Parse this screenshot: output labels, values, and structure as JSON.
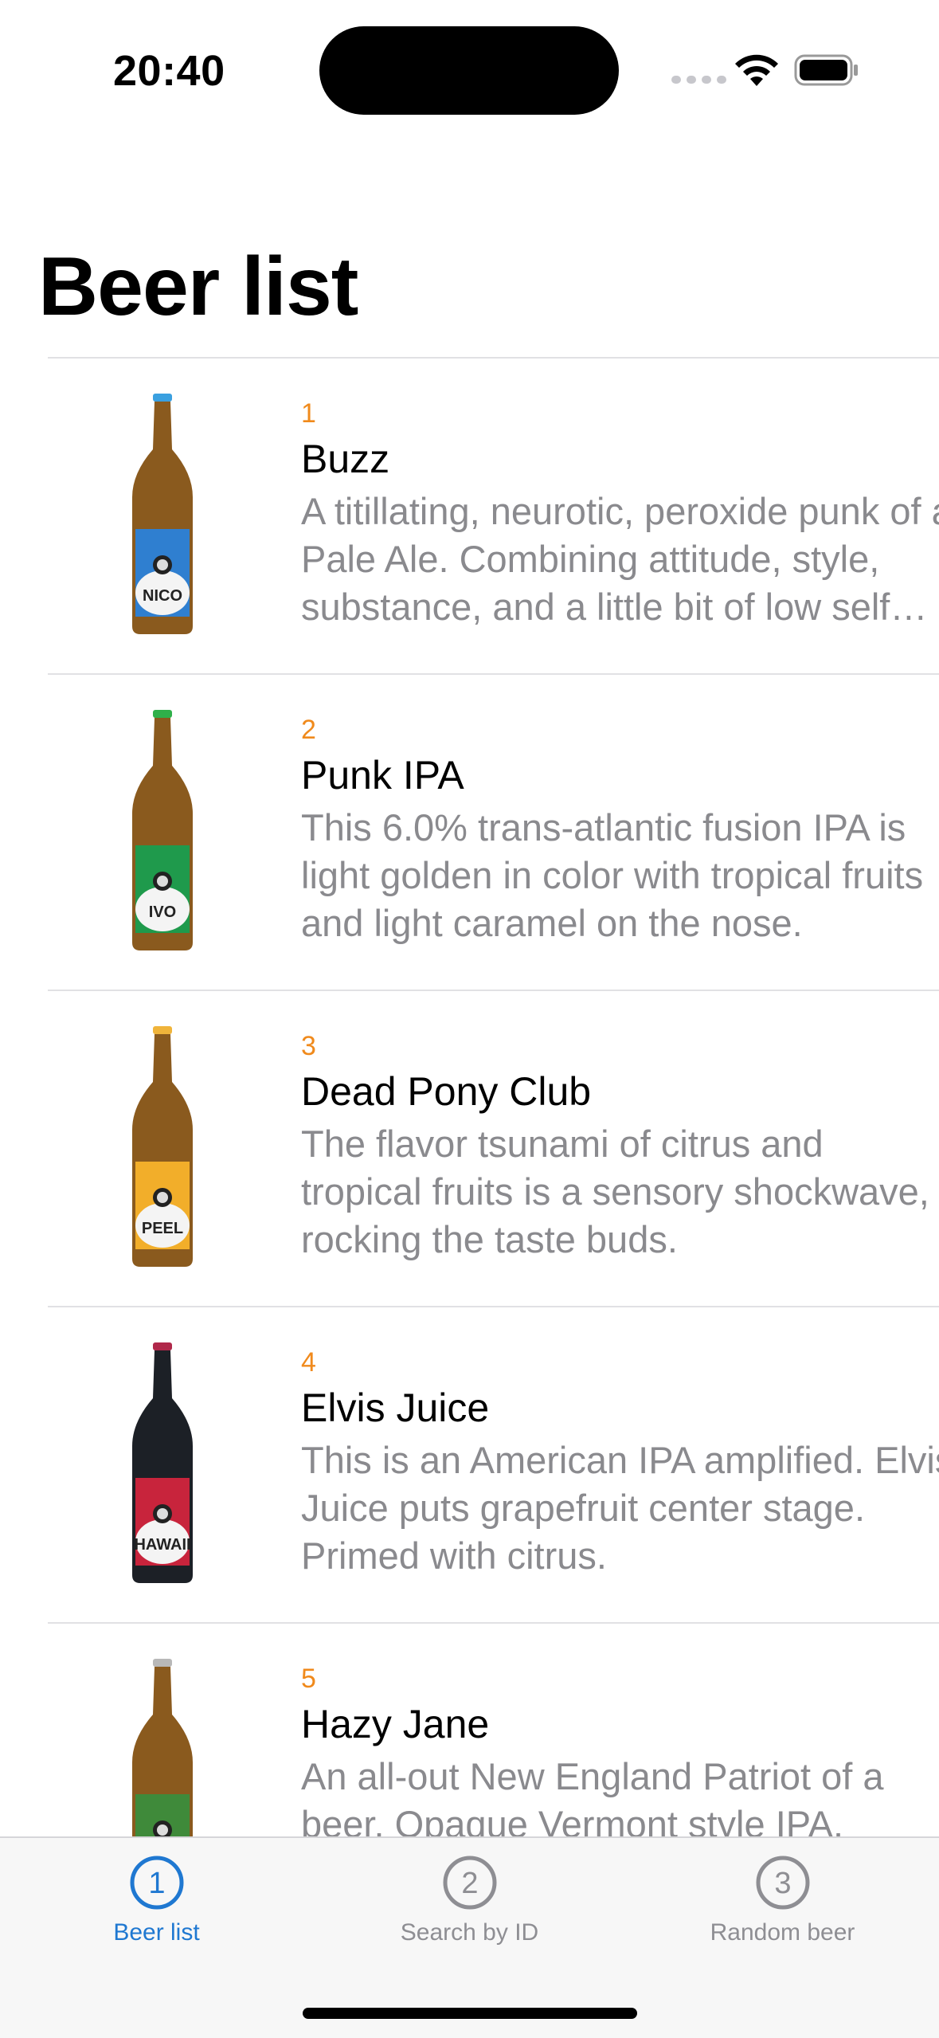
{
  "status": {
    "time": "20:40"
  },
  "title": "Beer list",
  "beers": [
    {
      "id": "1",
      "name": "Buzz",
      "description": "A titillating, neurotic, peroxide punk of a Pale Ale. Combining attitude, style, substance, and a little bit of low self esteem for good measure.",
      "label_color": "#2f7fd0",
      "label_text": "NICO",
      "cap_color": "#3aa0e0",
      "glass_color": "#8a5a1e"
    },
    {
      "id": "2",
      "name": "Punk IPA",
      "description": "This 6.0% trans-atlantic fusion IPA is light golden in color with tropical fruits and light caramel on the nose.",
      "label_color": "#1f9a4c",
      "label_text": "IVO",
      "cap_color": "#2fb04a",
      "glass_color": "#8a5a1e"
    },
    {
      "id": "3",
      "name": "Dead Pony Club",
      "description": "The flavor tsunami of citrus and tropical fruits is a sensory shockwave, rocking the taste buds.",
      "label_color": "#f2ae2a",
      "label_text": "PEEL",
      "cap_color": "#f0b43a",
      "glass_color": "#8a5a1e"
    },
    {
      "id": "4",
      "name": "Elvis Juice",
      "description": "This is an American IPA amplified. Elvis Juice puts grapefruit center stage. Primed with citrus.",
      "label_color": "#c8243c",
      "label_text": "HAWAII",
      "cap_color": "#b0284a",
      "glass_color": "#1c2026"
    },
    {
      "id": "5",
      "name": "Hazy Jane",
      "description": "An all-out New England Patriot of a beer. Opaque Vermont style IPA.",
      "label_color": "#3f8a3a",
      "label_text": "",
      "cap_color": "#b8b8b8",
      "glass_color": "#8a5a1e"
    }
  ],
  "tabs": [
    {
      "number": "1",
      "label": "Beer list",
      "active": true
    },
    {
      "number": "2",
      "label": "Search by ID",
      "active": false
    },
    {
      "number": "3",
      "label": "Random beer",
      "active": false
    }
  ],
  "colors": {
    "accent": "#1f78d1",
    "id_orange": "#f08a1c",
    "secondary_text": "#8a8a8e"
  }
}
